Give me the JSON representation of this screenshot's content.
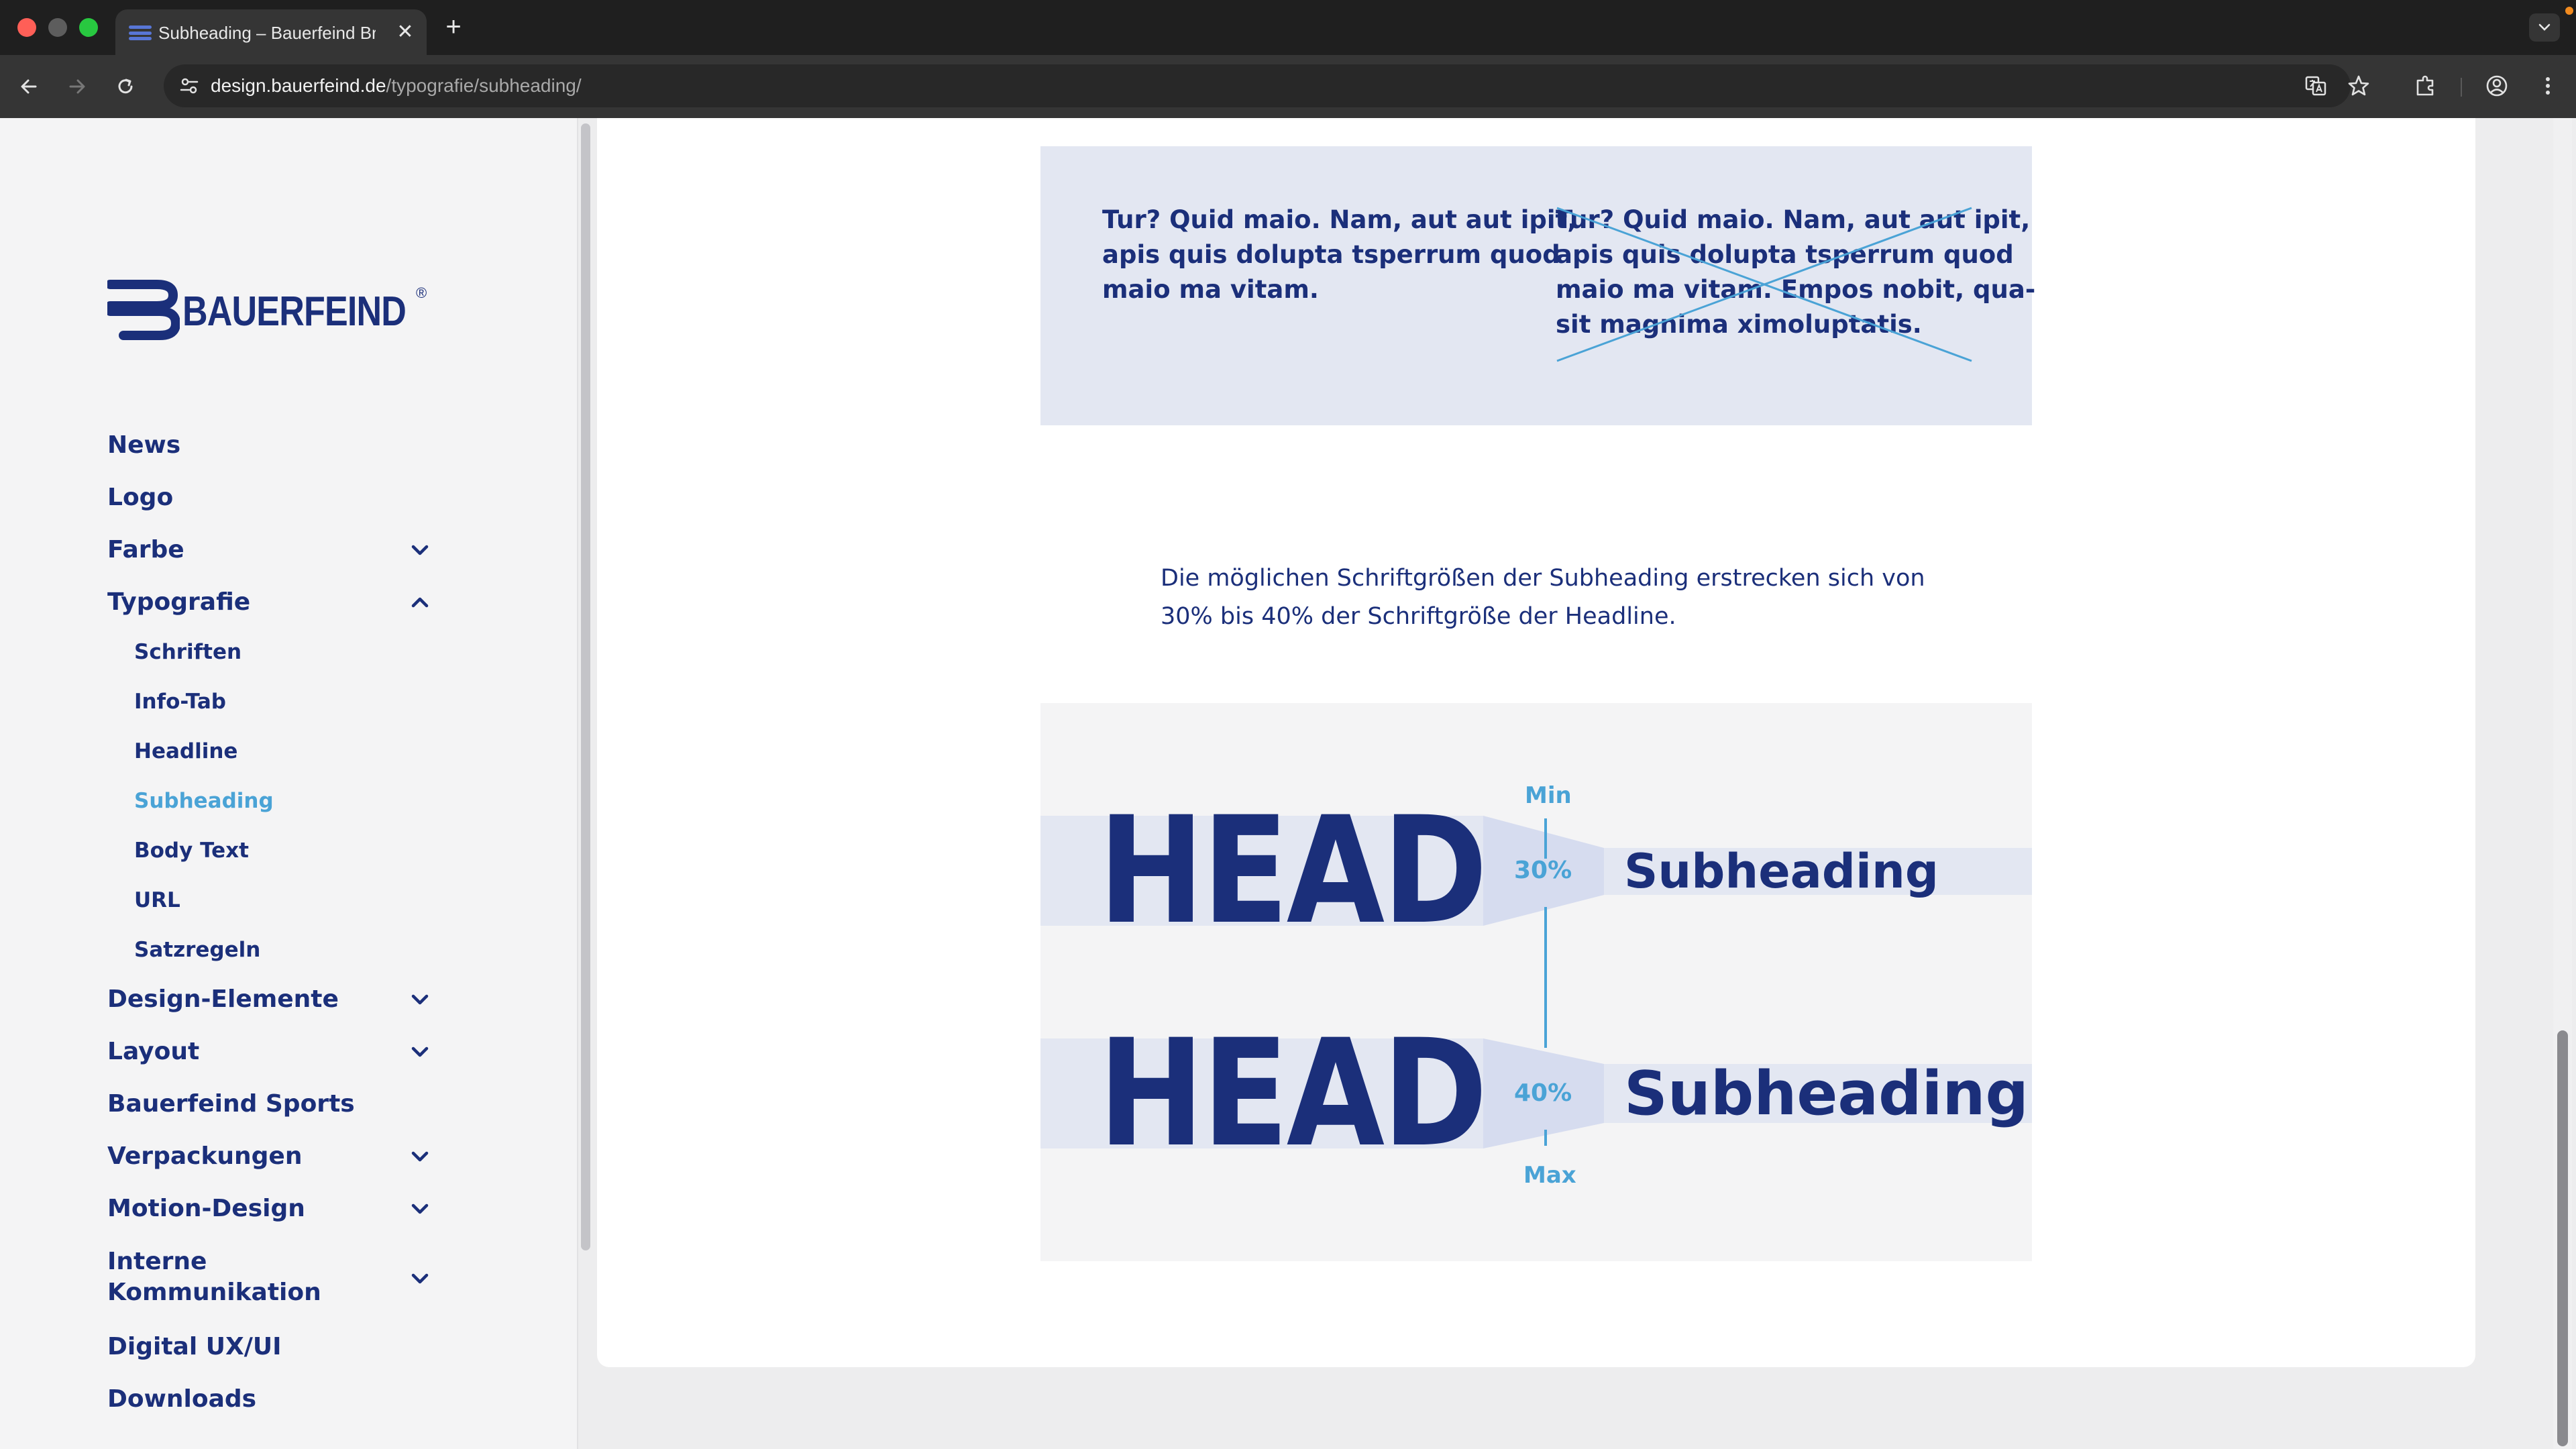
{
  "browser": {
    "tab_title": "Subheading – Bauerfeind Bra",
    "url_host": "design.bauerfeind.de",
    "url_path": "/typografie/subheading/",
    "icons": {
      "back": "arrow-left-icon",
      "forward": "arrow-right-icon",
      "reload": "reload-icon",
      "site_info": "tune-icon",
      "translate": "translate-icon",
      "bookmark": "star-icon",
      "extensions": "puzzle-icon",
      "profile": "profile-icon",
      "menu": "more-vertical-icon"
    }
  },
  "brand": {
    "name": "BAUERFEIND",
    "reg_mark": "®",
    "color_primary": "#1b2f7a",
    "color_accent": "#4aa3d6"
  },
  "sidebar": {
    "items": [
      {
        "label": "News",
        "expandable": false
      },
      {
        "label": "Logo",
        "expandable": false
      },
      {
        "label": "Farbe",
        "expandable": true,
        "expanded": false
      },
      {
        "label": "Typografie",
        "expandable": true,
        "expanded": true
      },
      {
        "label": "Design-Elemente",
        "expandable": true,
        "expanded": false
      },
      {
        "label": "Layout",
        "expandable": true,
        "expanded": false
      },
      {
        "label": "Bauerfeind Sports",
        "expandable": false
      },
      {
        "label": "Verpackungen",
        "expandable": true,
        "expanded": false
      },
      {
        "label": "Motion-Design",
        "expandable": true,
        "expanded": false
      },
      {
        "label": "Interne Kommunikation",
        "label_line1": "Interne",
        "label_line2": "Kommunikation",
        "expandable": true,
        "expanded": false
      },
      {
        "label": "Digital UX/UI",
        "expandable": false
      },
      {
        "label": "Downloads",
        "expandable": false
      }
    ],
    "typografie_subitems": [
      {
        "label": "Schriften",
        "active": false
      },
      {
        "label": "Info-Tab",
        "active": false
      },
      {
        "label": "Headline",
        "active": false
      },
      {
        "label": "Subheading",
        "active": true
      },
      {
        "label": "Body Text",
        "active": false
      },
      {
        "label": "URL",
        "active": false
      },
      {
        "label": "Satzregeln",
        "active": false
      }
    ]
  },
  "main": {
    "compare": {
      "good_text": "Tur? Quid maio. Nam, aut aut ipit,\napis quis dolupta tsperrum quod\nmaio ma vitam.",
      "bad_text": "Tur? Quid maio. Nam, aut aut ipit,\napis quis dolupta tsperrum quod\nmaio ma vitam. Empos nobit, qua-\nsit magnima ximoluptatis."
    },
    "description": "Die möglichen Schriftgrößen der Subheading erstrecken sich von\n30% bis 40% der Schriftgröße der Headline.",
    "diagram": {
      "min_label": "Min",
      "max_label": "Max",
      "rows": [
        {
          "head": "HEAD",
          "percent": "30%",
          "subheading": "Subheading"
        },
        {
          "head": "HEAD",
          "percent": "40%",
          "subheading": "Subheading"
        }
      ]
    }
  }
}
